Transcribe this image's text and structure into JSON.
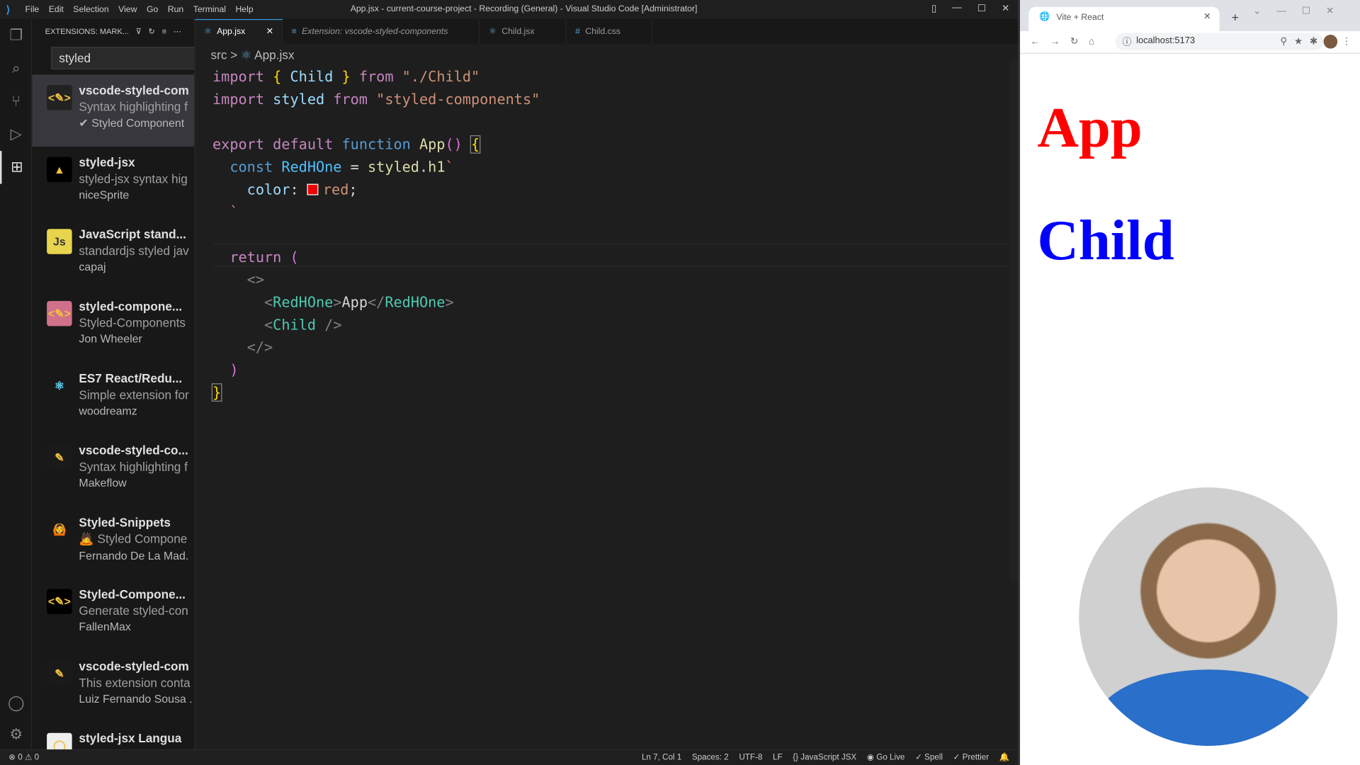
{
  "window": {
    "title": "App.jsx - current-course-project - Recording (General) - Visual Studio Code [Administrator]",
    "menu": [
      "File",
      "Edit",
      "Selection",
      "View",
      "Go",
      "Run",
      "Terminal",
      "Help"
    ]
  },
  "sidebar": {
    "title": "EXTENSIONS: MARK...",
    "search_value": "styled",
    "extensions": [
      {
        "name": "vscode-styled-com",
        "desc": "Syntax highlighting f",
        "publisher": "✔ Styled Component",
        "icon_bg": "#222"
      },
      {
        "name": "styled-jsx",
        "desc": "styled-jsx syntax hig",
        "publisher": "niceSprite",
        "icon_bg": "#000"
      },
      {
        "name": "JavaScript stand...",
        "desc": "standardjs styled jav",
        "publisher": "capaj",
        "icon_bg": "#e8d44d"
      },
      {
        "name": "styled-compone...",
        "desc": "Styled-Components",
        "publisher": "Jon Wheeler",
        "icon_bg": "#d0708a"
      },
      {
        "name": "ES7 React/Redu...",
        "desc": "Simple extension for",
        "publisher": "woodreamz",
        "icon_bg": "#181818"
      },
      {
        "name": "vscode-styled-co...",
        "desc": "Syntax highlighting f",
        "publisher": "Makeflow",
        "icon_bg": "#1a1a1a"
      },
      {
        "name": "Styled-Snippets",
        "desc": "🙇 Styled Compone",
        "publisher": "Fernando De La Mad.",
        "icon_bg": "#181818"
      },
      {
        "name": "Styled-Compone...",
        "desc": "Generate styled-con",
        "publisher": "FallenMax",
        "icon_bg": "#000"
      },
      {
        "name": "vscode-styled-com",
        "desc": "This extension conta",
        "publisher": "Luiz Fernando Sousa .",
        "icon_bg": "#1a1a1a"
      },
      {
        "name": "styled-jsx Langua",
        "desc": "",
        "publisher": "",
        "icon_bg": "#eee"
      }
    ]
  },
  "tabs": [
    {
      "label": "App.jsx",
      "icon": "react-icon"
    },
    {
      "label": "Extension: vscode-styled-components",
      "icon": "preview-icon"
    },
    {
      "label": "Child.jsx",
      "icon": "react-icon"
    },
    {
      "label": "Child.css",
      "icon": "hash-icon"
    }
  ],
  "breadcrumb": [
    "src",
    "App.jsx"
  ],
  "status": {
    "errors": "0",
    "warnings": "0",
    "position": "Ln 7, Col 1",
    "spaces": "Spaces: 2",
    "encoding": "UTF-8",
    "eol": "LF",
    "language": "JavaScript JSX",
    "golive": "Go Live",
    "spell": "Spell",
    "prettier": "Prettier"
  },
  "browser": {
    "tab_title": "Vite + React",
    "url": "localhost:5173",
    "heading_app": "App",
    "heading_child": "Child"
  }
}
